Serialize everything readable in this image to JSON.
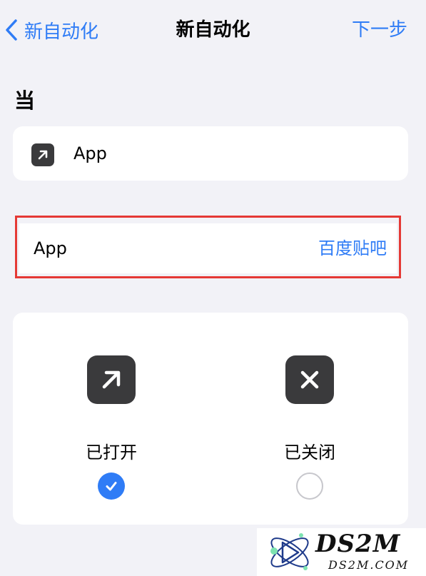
{
  "nav": {
    "back_label": "新自动化",
    "title": "新自动化",
    "next_label": "下一步"
  },
  "section": {
    "title": "当"
  },
  "trigger": {
    "icon": "arrow-up-right-icon",
    "label": "App"
  },
  "app_row": {
    "label": "App",
    "value": "百度贴吧"
  },
  "options": [
    {
      "label": "已打开",
      "icon": "arrow-up-right-icon",
      "checked": true
    },
    {
      "label": "已关闭",
      "icon": "close-x-icon",
      "checked": false
    }
  ],
  "watermark": {
    "name": "DS2M",
    "url": "DS2M.COM"
  },
  "colors": {
    "accent": "#2f7cf6",
    "background": "#f2f2f7",
    "icon_bg": "#3a3a3c",
    "highlight_border": "#e53935"
  }
}
